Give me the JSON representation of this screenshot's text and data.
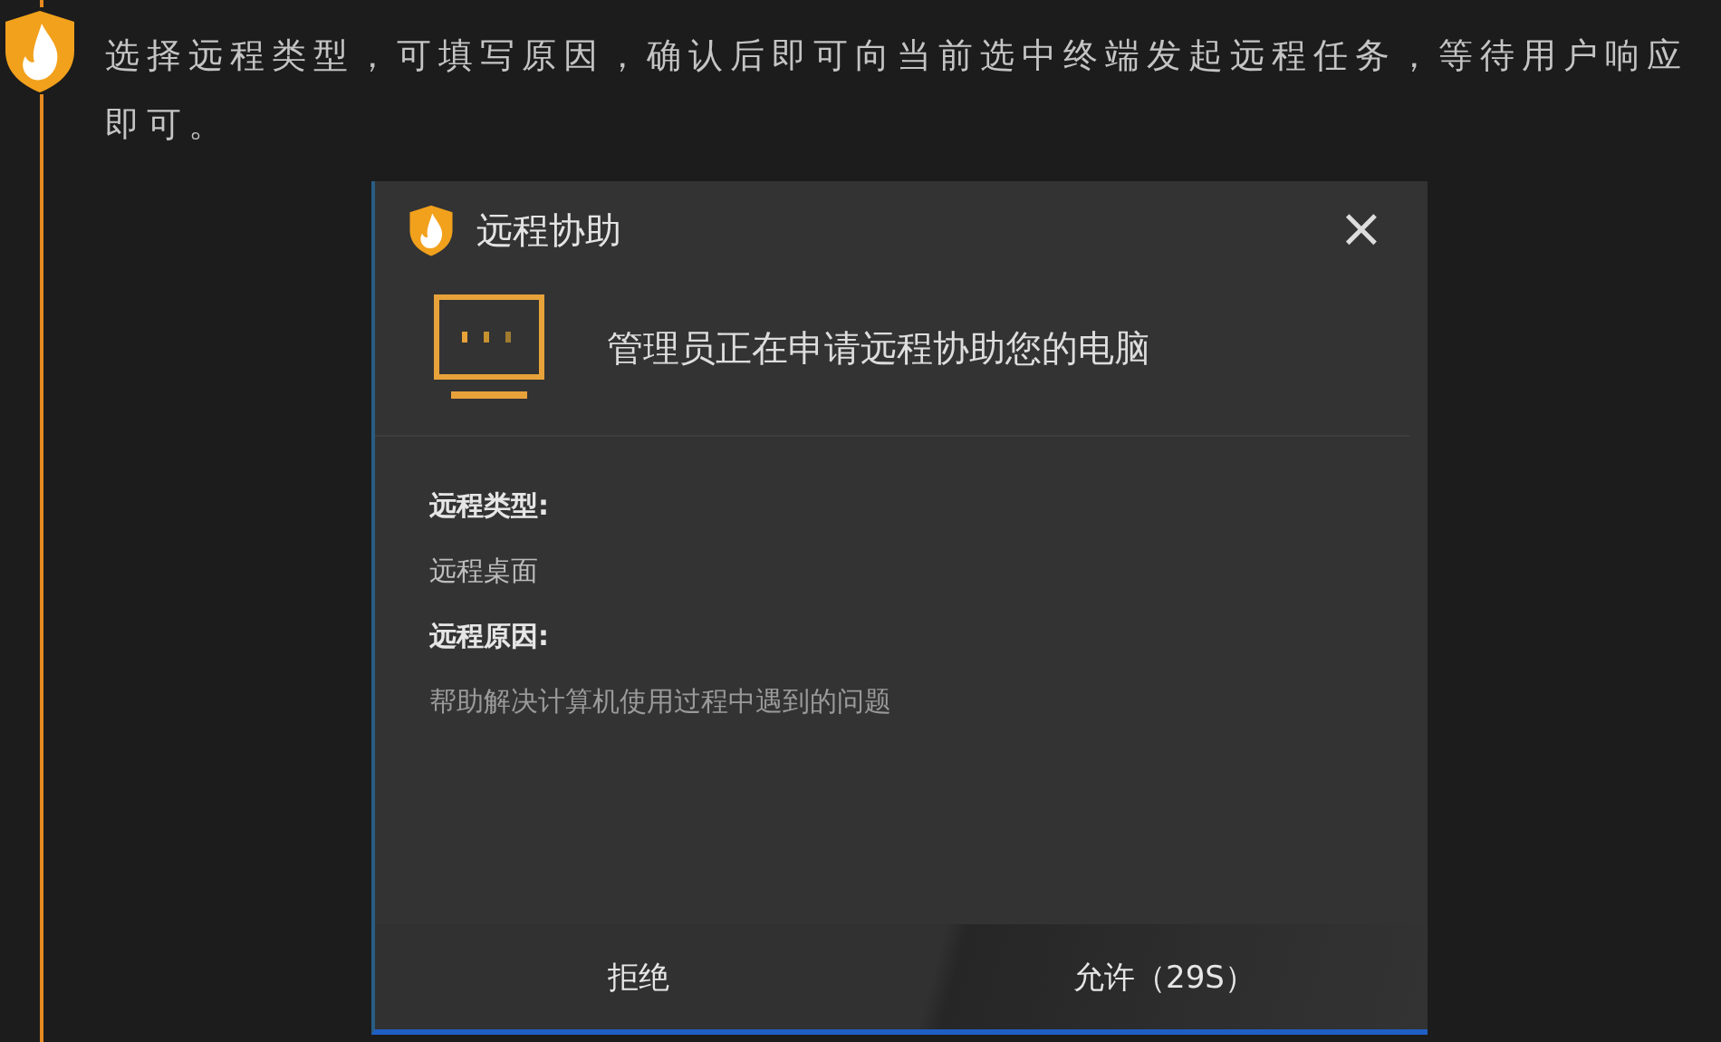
{
  "description": "选择远程类型，可填写原因，确认后即可向当前选中终端发起远程任务，等待用户响应即可。",
  "dialog": {
    "title": "远程协助",
    "close": "×",
    "message": "管理员正在申请远程协助您的电脑",
    "fields": [
      {
        "label": "远程类型:",
        "value": "远程桌面"
      },
      {
        "label": "远程原因:",
        "value": "帮助解决计算机使用过程中遇到的问题"
      }
    ],
    "buttons": [
      {
        "label": "拒绝",
        "kind": "reject"
      },
      {
        "label": "允许（29S）",
        "kind": "allow"
      }
    ]
  }
}
